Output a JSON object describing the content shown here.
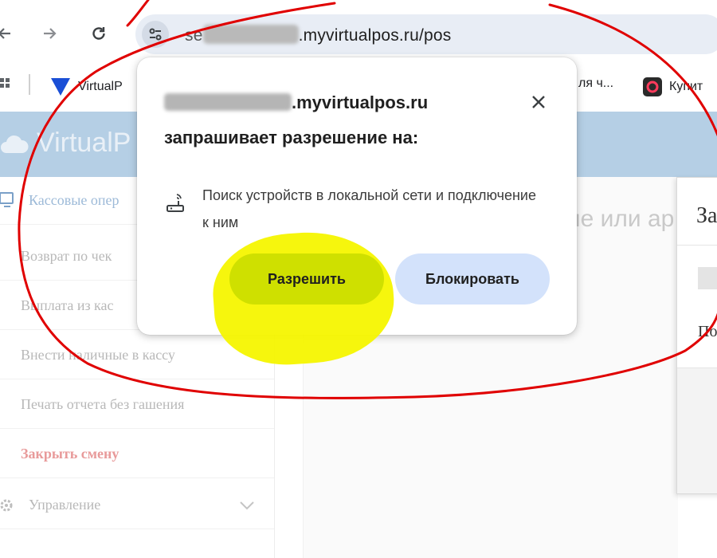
{
  "browser": {
    "url_prefix": "se",
    "url_domain": ".myvirtualpos.ru/pos"
  },
  "bookmarks": [
    {
      "label": "VirtualP"
    },
    {
      "label": "ля ч..."
    },
    {
      "label": "Купит"
    }
  ],
  "app": {
    "logo_text": "VirtualP"
  },
  "sidebar": {
    "section_label": "Кассовые опер",
    "items": [
      {
        "label": "Возврат по чек"
      },
      {
        "label": "Выплата из кас"
      },
      {
        "label": "Внести наличные в кассу"
      },
      {
        "label": "Печать отчета без гашения"
      },
      {
        "label": "Закрыть смену"
      }
    ],
    "group_label": "Управление"
  },
  "main": {
    "search_hint": "не или ар"
  },
  "side_dialog": {
    "title_fragment": "За",
    "text_fragment": "По"
  },
  "popup": {
    "origin_domain": ".myvirtualpos.ru",
    "title": "запрашивает разрешение на:",
    "permission_text": "Поиск устройств в локальной сети и подключение к ним",
    "allow_label": "Разрешить",
    "block_label": "Блокировать"
  },
  "colors": {
    "allow_button": "#cfe000",
    "block_button": "#d3e2fb",
    "annotation_circle": "#e00000",
    "annotation_highlight": "#f6f500"
  }
}
